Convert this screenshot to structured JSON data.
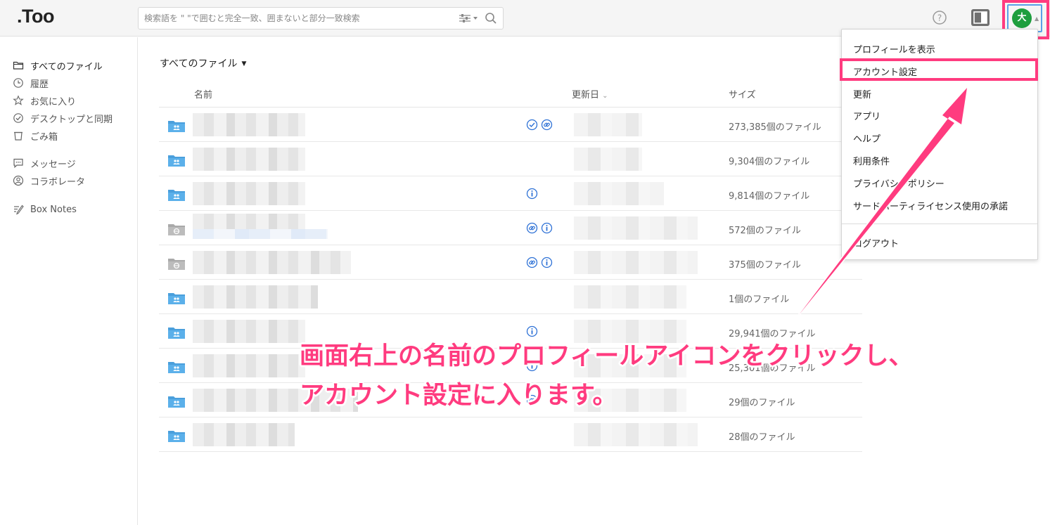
{
  "header": {
    "logo": ".Too",
    "search_placeholder": "検索語を \" \"で囲むと完全一致、囲まないと部分一致検索",
    "avatar_initial": "大"
  },
  "sidebar": {
    "items": [
      {
        "label": "すべてのファイル",
        "icon": "folder-icon"
      },
      {
        "label": "履歴",
        "icon": "clock-icon"
      },
      {
        "label": "お気に入り",
        "icon": "star-icon"
      },
      {
        "label": "デスクトップと同期",
        "icon": "check-circle-icon"
      },
      {
        "label": "ごみ箱",
        "icon": "trash-icon"
      },
      {
        "label": "メッセージ",
        "icon": "chat-icon"
      },
      {
        "label": "コラボレータ",
        "icon": "person-icon"
      },
      {
        "label": "Box Notes",
        "icon": "notes-icon"
      }
    ]
  },
  "main": {
    "breadcrumb": "すべてのファイル",
    "columns": {
      "name": "名前",
      "updated": "更新日",
      "size": "サイズ"
    },
    "rows": [
      {
        "type": "shared-folder",
        "badges": [
          "check",
          "link"
        ],
        "count": "273,385個のファイル"
      },
      {
        "type": "shared-folder",
        "badges": [],
        "count": "9,304個のファイル"
      },
      {
        "type": "shared-folder",
        "badges": [
          "info"
        ],
        "count": "9,814個のファイル"
      },
      {
        "type": "web-folder",
        "badges": [
          "link",
          "info"
        ],
        "count": "572個のファイル"
      },
      {
        "type": "web-folder",
        "badges": [
          "link",
          "info"
        ],
        "count": "375個のファイル"
      },
      {
        "type": "shared-folder",
        "badges": [],
        "count": "1個のファイル"
      },
      {
        "type": "shared-folder",
        "badges": [
          "info"
        ],
        "count": "29,941個のファイル"
      },
      {
        "type": "shared-folder",
        "badges": [
          "info"
        ],
        "count": "25,301個のファイル"
      },
      {
        "type": "shared-folder",
        "badges": [
          "link"
        ],
        "count": "29個のファイル"
      },
      {
        "type": "shared-folder",
        "badges": [],
        "count": "28個のファイル"
      }
    ]
  },
  "menu": {
    "items": [
      "プロフィールを表示",
      "アカウント設定",
      "更新",
      "アプリ",
      "ヘルプ",
      "利用条件",
      "プライバシーポリシー",
      "サードパーティライセンス使用の承諾"
    ],
    "logout": "ログアウト"
  },
  "annotation": {
    "line1": "画面右上の名前のプロフィールアイコンをクリックし、",
    "line2": "アカウント設定に入ります。",
    "color": "#ff3b7f"
  }
}
